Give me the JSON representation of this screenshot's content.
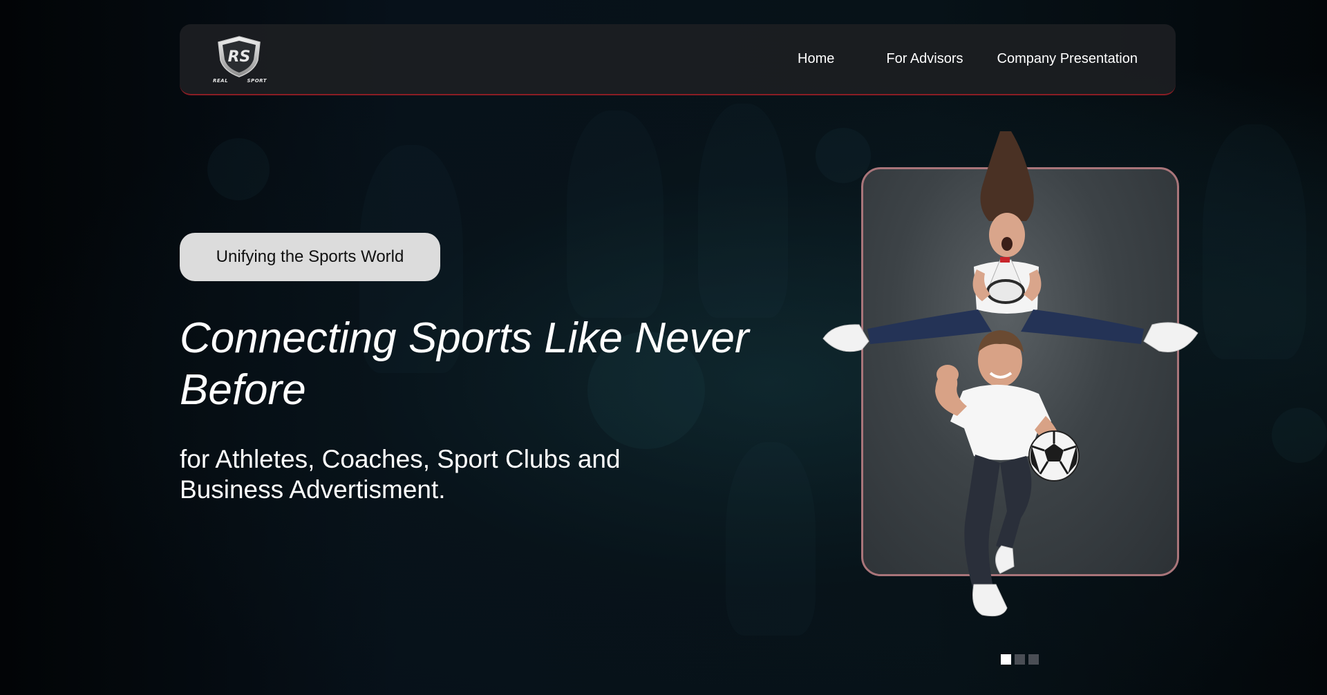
{
  "brand": {
    "logo_letters": "RS",
    "logo_sub_left": "REAL",
    "logo_sub_right": "SPORT",
    "accent_color": "#8a1d24"
  },
  "nav": {
    "items": [
      {
        "label": "Home"
      },
      {
        "label": "For Advisors"
      },
      {
        "label": "Company Presentation"
      }
    ]
  },
  "hero": {
    "tagline": "Unifying the Sports World",
    "headline": "Connecting Sports Like Never Before",
    "subheadline": "for Athletes, Coaches, Sport Clubs and Business Advertisment.",
    "frame_border_color": "#a9757a"
  },
  "carousel": {
    "slide_count": 3,
    "active_index": 0
  },
  "icons": [
    "shield-logo-icon",
    "megaphone-icon",
    "soccer-ball-icon"
  ]
}
